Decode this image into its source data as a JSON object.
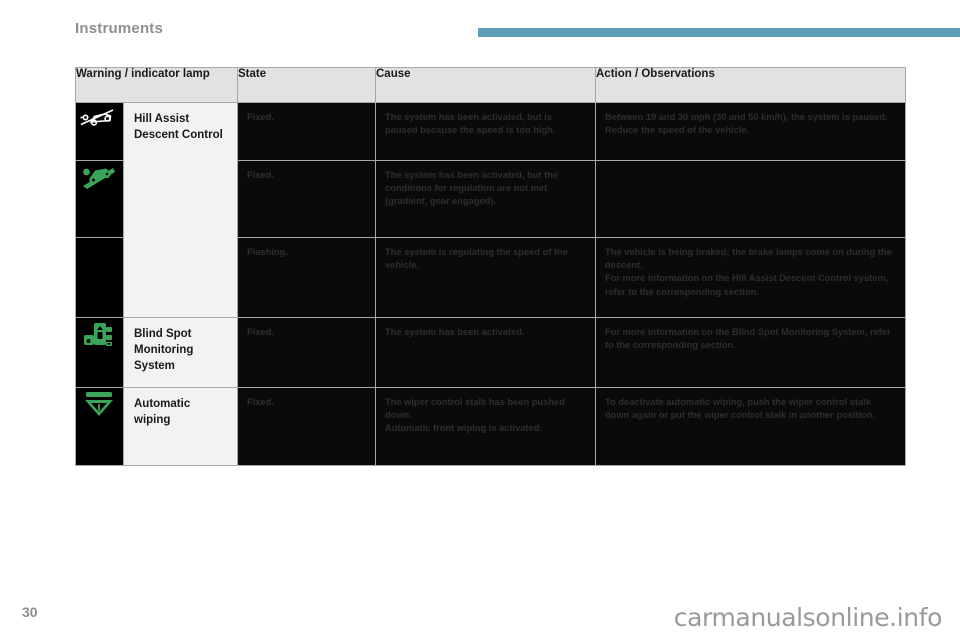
{
  "header": {
    "section_title": "Instruments",
    "rule_color": "#5d9fb8"
  },
  "table": {
    "columns": [
      {
        "key": "lamp",
        "label": "Warning / indicator lamp"
      },
      {
        "key": "state",
        "label": "State"
      },
      {
        "key": "cause",
        "label": "Cause"
      },
      {
        "key": "action",
        "label": "Action / Observations"
      }
    ],
    "rows": [
      {
        "icon": "car-on-slope-descent-icon",
        "icon_color": "#ffffff",
        "lamp": "Hill Assist\nDescent Control",
        "state": "Fixed.",
        "cause": "The system has been activated, but is paused because the speed is too high.",
        "action": "Between 19 and 30 mph (30 and 50 km/h), the system is paused.\nReduce the speed of the vehicle."
      },
      {
        "icon": "car-on-slope-green-icon",
        "icon_color": "#3aa559",
        "lamp": "",
        "state": "Fixed.",
        "cause": "The system has been activated, but the conditions for regulation are not met (gradient, gear engaged).",
        "action": ""
      },
      {
        "icon": "",
        "icon_color": "",
        "lamp": "",
        "state": "Flashing.",
        "cause": "The system is regulating the speed of the vehicle.",
        "action": "The vehicle is being braked; the brake lamps come on during the descent.\nFor more information on the Hill Assist Descent Control system, refer to the corresponding section."
      },
      {
        "icon": "blind-spot-monitoring-icon",
        "icon_color": "#3aa559",
        "lamp": "Blind Spot\nMonitoring\nSystem",
        "state": "Fixed.",
        "cause": "The system has been activated.",
        "action": "For more information on the Blind Spot Monitoring System, refer to the corresponding section."
      },
      {
        "icon": "automatic-wiping-icon",
        "icon_color": "#3aa559",
        "lamp": "Automatic\nwiping",
        "state": "Fixed.",
        "cause": "The wiper control stalk has been pushed down.\nAutomatic front wiping is activated.",
        "action": "To deactivate automatic wiping, push the wiper control stalk down again or put the wiper control stalk in another position."
      }
    ]
  },
  "footer": {
    "page_number": "30",
    "watermark": "carmanualsonline.info"
  }
}
